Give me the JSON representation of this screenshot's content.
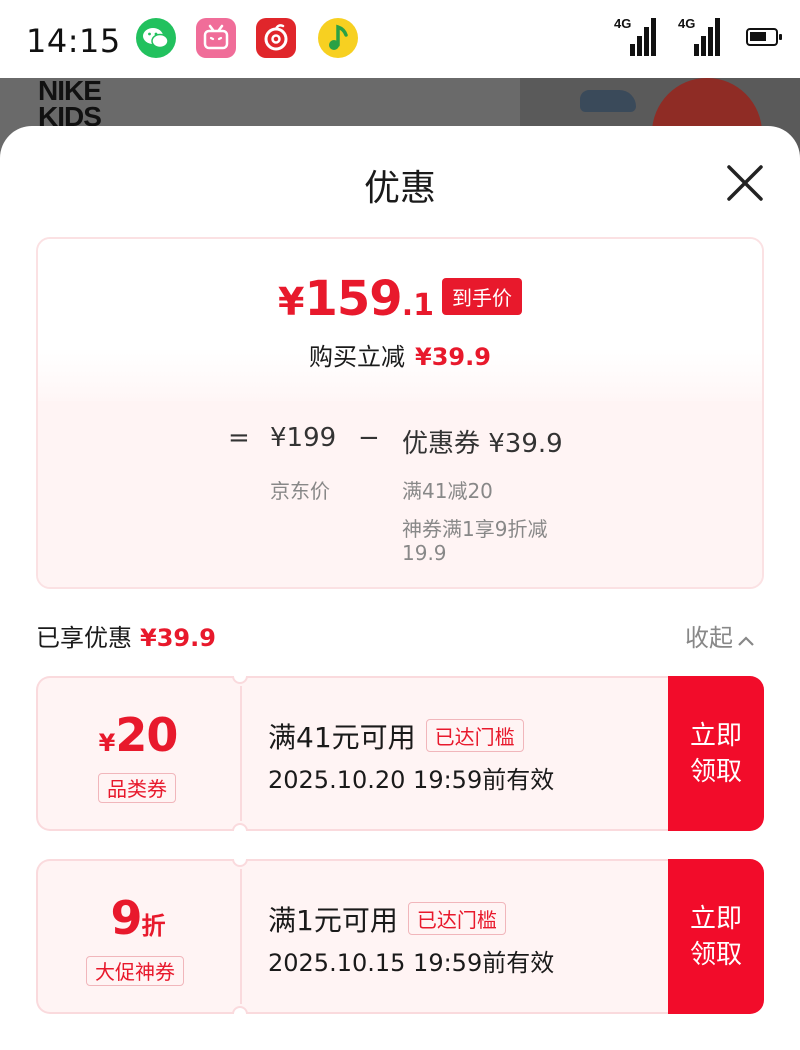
{
  "status_bar": {
    "time": "14:15",
    "apps": [
      "wechat-icon",
      "bilibili-icon",
      "netease-music-icon",
      "qq-music-icon"
    ],
    "signals": [
      "4G",
      "4G"
    ],
    "battery_level": 0.7
  },
  "banner": {
    "logo_text": "NIKE\nKIDS"
  },
  "sheet": {
    "title": "优惠"
  },
  "price_card": {
    "yen": "¥",
    "final_int": "159",
    "final_dec": ".1",
    "final_tag": "到手价",
    "instant_label": "购买立减",
    "instant_amount": "¥39.9",
    "eq": "=",
    "jd_price": "¥199",
    "minus": "−",
    "coupon_label": "优惠券 ¥39.9",
    "jd_price_label": "京东价",
    "coupon_detail_1": "满41减20",
    "coupon_detail_2": "神券满1享9折减",
    "coupon_detail_3": "19.9"
  },
  "enjoyed": {
    "label": "已享优惠",
    "amount": "¥39.9",
    "collapse_label": "收起"
  },
  "coupons": [
    {
      "value_prefix": "¥",
      "value_main": "20",
      "value_suffix": "",
      "type": "品类券",
      "condition": "满41元可用",
      "threshold_tag": "已达门槛",
      "expiry": "2025.10.20 19:59前有效",
      "claim_line1": "立即",
      "claim_line2": "领取"
    },
    {
      "value_prefix": "",
      "value_main": "9",
      "value_suffix": "折",
      "type": "大促神券",
      "condition": "满1元可用",
      "threshold_tag": "已达门槛",
      "expiry": "2025.10.15 19:59前有效",
      "claim_line1": "立即",
      "claim_line2": "领取"
    }
  ],
  "colors": {
    "accent_red": "#e8192c",
    "claim_red": "#f20c2a",
    "coupon_bg": "#fff4f4"
  }
}
